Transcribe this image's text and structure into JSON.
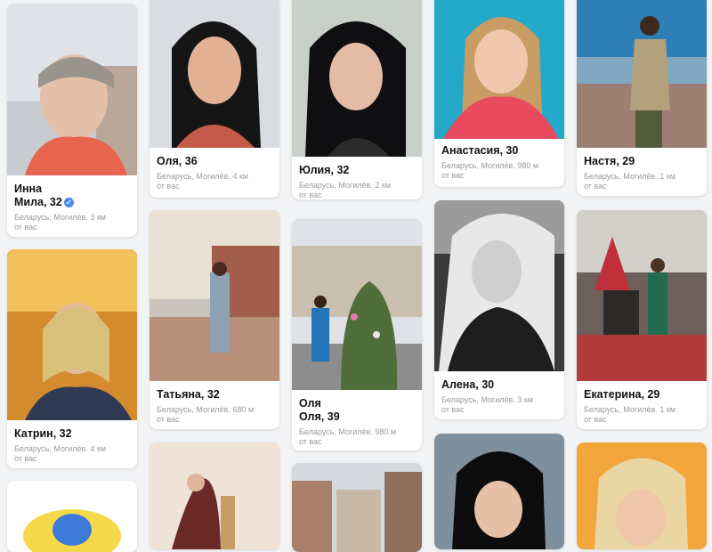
{
  "profiles": [
    {
      "name_line1": "Инна",
      "name_line2": "Мила, 32",
      "location": "Беларусь, Могилёв.",
      "distance": "3 км",
      "suffix": "от вас",
      "verified": true
    },
    {
      "name": "Катрин, 32",
      "location": "Беларусь, Могилёв.",
      "distance": "4 км",
      "suffix": "от вас"
    },
    {
      "name": "Оля, 36",
      "location": "Беларусь, Могилёв.",
      "distance": "4 км",
      "suffix": "от вас"
    },
    {
      "name": "Татьяна, 32",
      "location": "Беларусь, Могилёв.",
      "distance": "680 м",
      "suffix": "от вас"
    },
    {
      "name": "Юлия, 32",
      "location": "Беларусь, Могилёв.",
      "distance": "2 км",
      "suffix": "от вас"
    },
    {
      "name_line1": "Оля",
      "name_line2": "Оля, 39",
      "location": "Беларусь, Могилёв.",
      "distance": "980 м",
      "suffix": "от вас"
    },
    {
      "name": "Анастасия, 30",
      "location": "Беларусь, Могилёв.",
      "distance": "980 м",
      "suffix": "от вас"
    },
    {
      "name": "Алена, 30",
      "location": "Беларусь, Могилёв.",
      "distance": "3 км",
      "suffix": "от вас"
    },
    {
      "name": "Настя, 29",
      "location": "Беларусь, Могилёв.",
      "distance": "1 км",
      "suffix": "от вас"
    },
    {
      "name": "Екатерина, 29",
      "location": "Беларусь, Могилёв.",
      "distance": "1 км",
      "suffix": "от вас"
    }
  ],
  "colors": {
    "card_bg": "#ffffff",
    "page_bg": "#f2f3f5",
    "name_text": "#111111",
    "meta_text": "#9a9a9a",
    "verified_badge": "#4a8ae8"
  }
}
